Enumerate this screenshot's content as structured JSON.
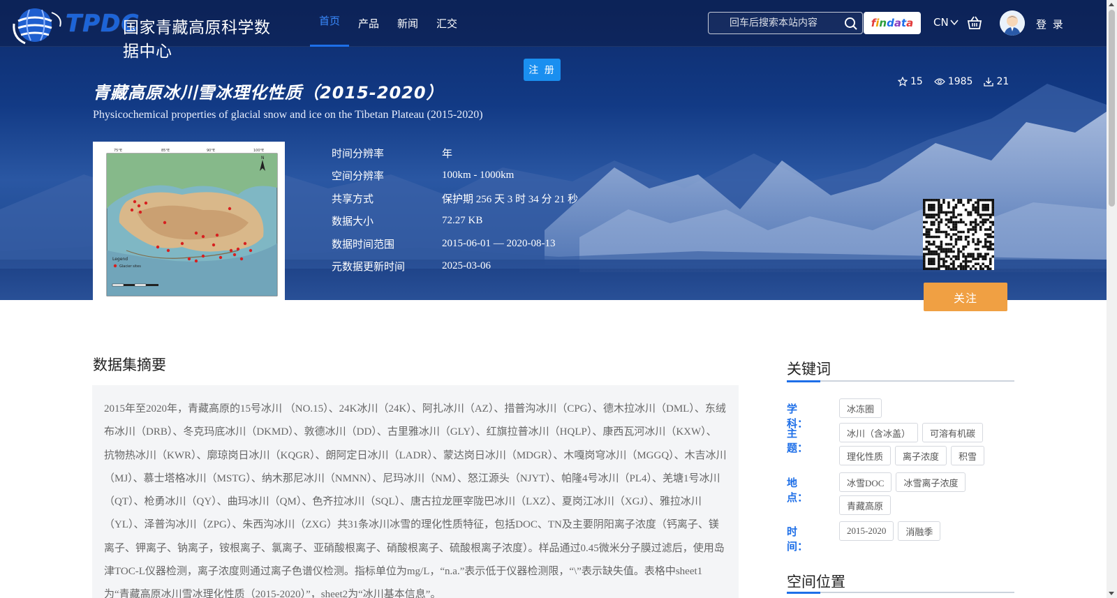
{
  "header": {
    "logo_text": "TPDC",
    "site_name": "国家青藏高原科学数据中心",
    "nav": [
      {
        "label": "首页",
        "active": true
      },
      {
        "label": "产品"
      },
      {
        "label": "新闻"
      },
      {
        "label": "汇交"
      }
    ],
    "search_placeholder": "回车后搜索本站内容",
    "findata_label": "findata",
    "lang": "CN",
    "login": "登 录",
    "register": "注 册"
  },
  "dataset": {
    "title_cn": "青藏高原冰川雪冰理化性质（2015-2020）",
    "title_en": "Physicochemical properties of glacial snow and ice on the Tibetan Plateau (2015-2020)",
    "stats": {
      "stars": "15",
      "views": "1985",
      "downloads": "21"
    },
    "meta": [
      {
        "key": "时间分辨率",
        "value": "年"
      },
      {
        "key": "空间分辨率",
        "value": "100km - 1000km"
      },
      {
        "key": "共享方式",
        "value": "保护期 256 天 3 时 34 分 21 秒"
      },
      {
        "key": "数据大小",
        "value": "72.27 KB"
      },
      {
        "key": "数据时间范围",
        "value": "2015-06-01 — 2020-08-13"
      },
      {
        "key": "元数据更新时间",
        "value": "2025-03-06"
      }
    ],
    "follow": "关注",
    "map_labels": {
      "lon": [
        "75°E",
        "85°E",
        "90°E",
        "100°E"
      ],
      "legend_title": "Legend",
      "legend_item": "Glacier sites"
    }
  },
  "abstract": {
    "heading": "数据集摘要",
    "text": "2015年至2020年，青藏高原的15号冰川 （NO.15）、24K冰川（24K）、阿扎冰川（AZ）、措普沟冰川（CPG）、德木拉冰川（DML）、东绒布冰川（DRB）、冬克玛底冰川（DKMD）、敦德冰川（DD）、古里雅冰川（GLY）、红旗拉普冰川（HQLP）、康西瓦河冰川（KXW）、抗物热冰川（KWR）、廓琼岗日冰川（KQGR）、朗阿定日冰川（LADR）、蒙达岗日冰川（MDGR）、木嘎岗穹冰川（MGGQ）、木吉冰川（MJ）、慕士塔格冰川（MSTG）、纳木那尼冰川（NMNN）、尼玛冰川（NM）、怒江源头（NJYT）、帕隆4号冰川（PL4）、羌塘1号冰川（QT）、枪勇冰川（QY）、曲玛冰川（QM）、色齐拉冰川（SQL）、唐古拉龙匣宰陇巴冰川（LXZ）、夏岗江冰川（XGJ）、雅拉冰川（YL）、泽普沟冰川（ZPG）、朱西沟冰川（ZXG）共31条冰川冰雪的理化性质特征，包括DOC、TN及主要阴阳离子浓度（钙离子、镁离子、钾离子、钠离子，铵根离子、氯离子、亚硝酸根离子、硝酸根离子、硫酸根离子浓度）。样品通过0.45微米分子膜过滤后，使用岛津TOC-L仪器检测，离子浓度则通过离子色谱仪检测。指标单位为mg/L，“n.a.”表示低于仪器检测限，“\\”表示缺失值。表格中sheet1为“青藏高原冰川雪冰理化性质（2015-2020）”，sheet2为“冰川基本信息”。"
  },
  "keywords": {
    "heading": "关键词",
    "groups": [
      {
        "label": "学科：",
        "tags": [
          "冰冻圈"
        ]
      },
      {
        "label": "主题：",
        "tags": [
          "冰川（含冰盖）",
          "可溶有机碳",
          "理化性质",
          "离子浓度",
          "积雪"
        ]
      },
      {
        "label": "地点：",
        "tags": [
          "冰雪DOC",
          "冰雪离子浓度",
          "青藏高原"
        ]
      },
      {
        "label": "时间：",
        "tags": [
          "2015-2020",
          "消融季"
        ]
      }
    ]
  },
  "spatial": {
    "heading": "空间位置"
  },
  "colors": {
    "accent": "#1e6fe8",
    "follow": "#f0a043",
    "register": "#1a8ff0"
  }
}
